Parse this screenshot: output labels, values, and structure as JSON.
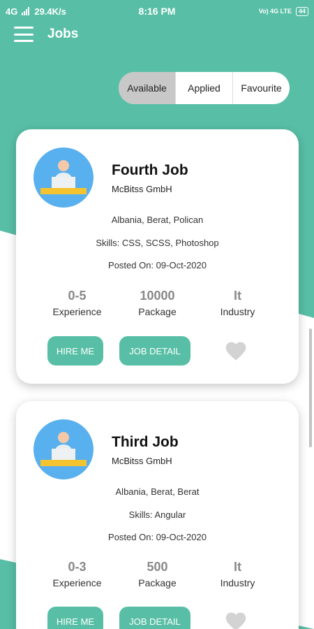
{
  "status_bar": {
    "network": "4G",
    "speed": "29.4K/s",
    "time": "8:16 PM",
    "carrier": "Vo) 4G LTE",
    "battery": "44"
  },
  "app_bar": {
    "title": "Jobs",
    "menu_icon": "hamburger-menu-icon"
  },
  "tabs": [
    {
      "label": "Available",
      "active": true
    },
    {
      "label": "Applied",
      "active": false
    },
    {
      "label": "Favourite",
      "active": false
    }
  ],
  "jobs": [
    {
      "title": "Fourth Job",
      "company": "McBitss GmbH",
      "location": "Albania, Berat, Polican",
      "skills": "Skills: CSS, SCSS, Photoshop",
      "posted": "Posted On: 09-Oct-2020",
      "experience_value": "0-5",
      "experience_label": "Experience",
      "package_value": "10000",
      "package_label": "Package",
      "industry_value": "It",
      "industry_label": "Industry",
      "hire_label": "HIRE ME",
      "detail_label": "JOB DETAIL"
    },
    {
      "title": "Third Job",
      "company": "McBitss GmbH",
      "location": "Albania, Berat, Berat",
      "skills": "Skills: Angular",
      "posted": "Posted On: 09-Oct-2020",
      "experience_value": "0-3",
      "experience_label": "Experience",
      "package_value": "500",
      "package_label": "Package",
      "industry_value": "It",
      "industry_label": "Industry",
      "hire_label": "HIRE ME",
      "detail_label": "JOB DETAIL"
    }
  ],
  "colors": {
    "accent": "#58bfa6",
    "avatar_bg": "#59b0ef",
    "heart": "#d3d3d3"
  }
}
